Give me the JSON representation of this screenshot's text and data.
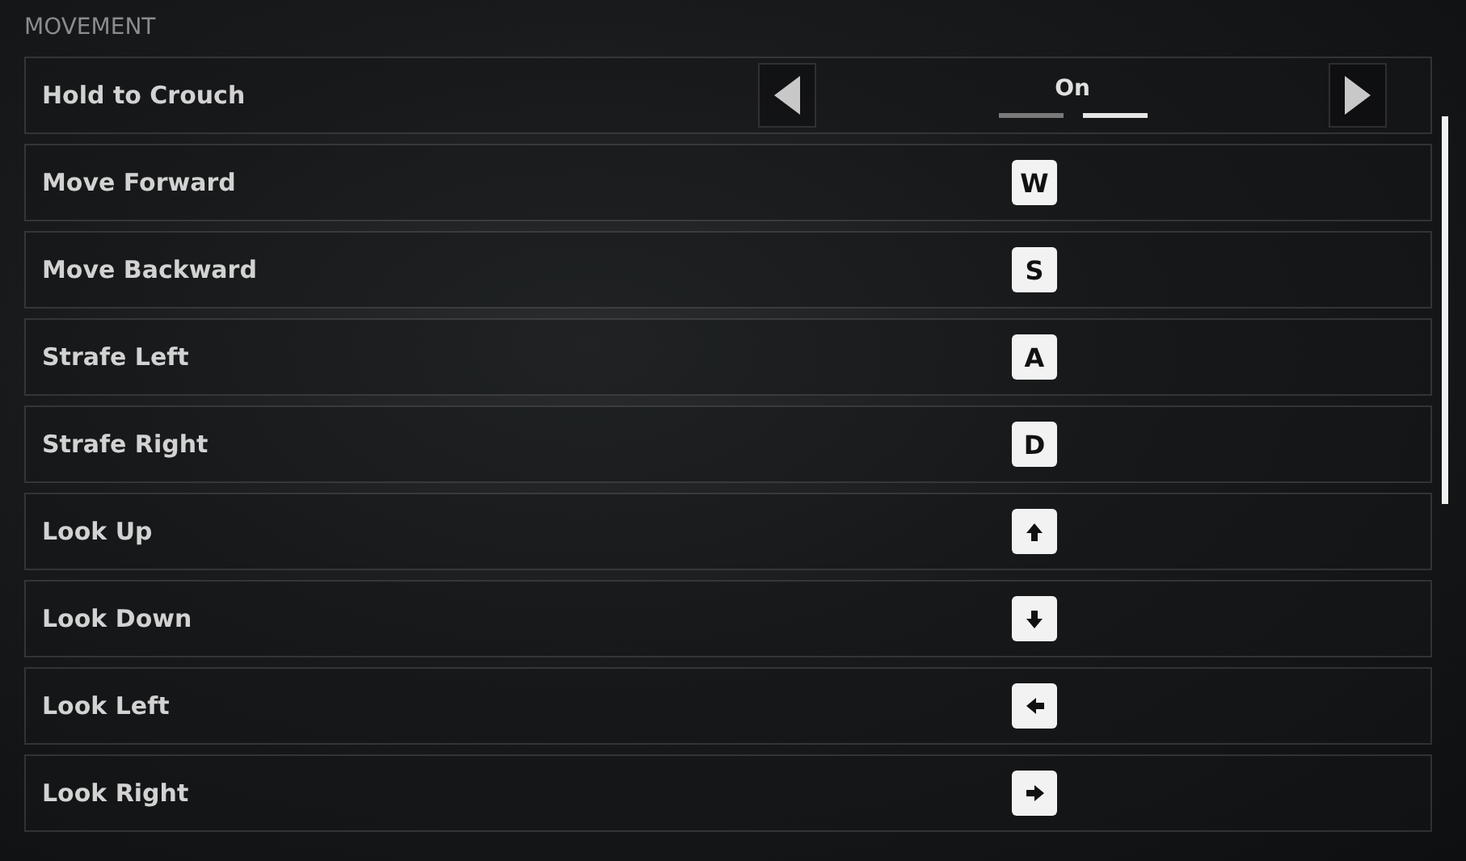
{
  "section": {
    "title": "MOVEMENT"
  },
  "rows": [
    {
      "label": "Hold to Crouch",
      "kind": "toggle",
      "value": "On",
      "pips": [
        {
          "selected": false
        },
        {
          "selected": true
        }
      ]
    },
    {
      "label": "Move Forward",
      "kind": "key",
      "key": "W"
    },
    {
      "label": "Move Backward",
      "kind": "key",
      "key": "S"
    },
    {
      "label": "Strafe Left",
      "kind": "key",
      "key": "A"
    },
    {
      "label": "Strafe Right",
      "kind": "key",
      "key": "D"
    },
    {
      "label": "Look Up",
      "kind": "uparrow"
    },
    {
      "label": "Look Down",
      "kind": "downarrow"
    },
    {
      "label": "Look Left",
      "kind": "leftarrow"
    },
    {
      "label": "Look Right",
      "kind": "rightarrow"
    }
  ]
}
